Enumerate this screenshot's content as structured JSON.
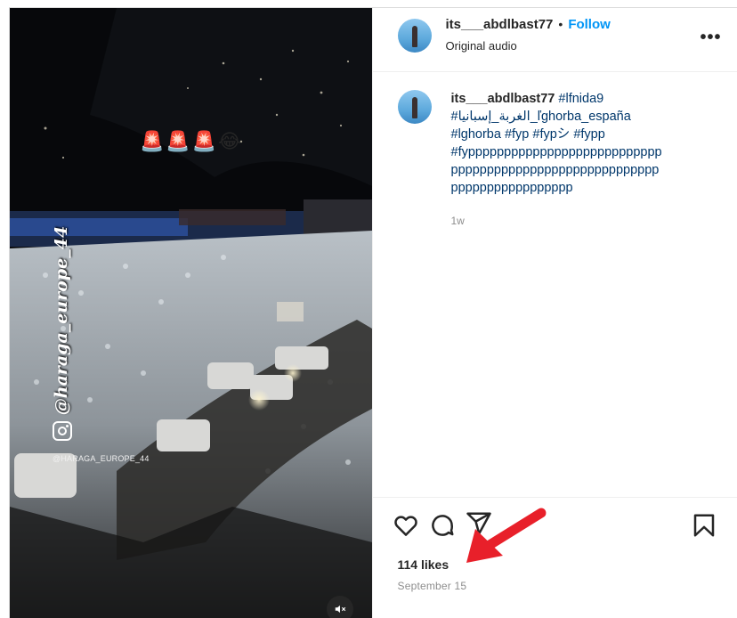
{
  "media": {
    "emoji_row": "🚨🚨🚨😂",
    "watermark_vertical": "@haraga_europe_44",
    "watermark_small": "@HARAGA_EUROPE_44",
    "icons": [
      "instagram-logo-icon",
      "mute-icon"
    ]
  },
  "header": {
    "username": "its___abdlbast77",
    "separator": "•",
    "follow_label": "Follow",
    "subtitle": "Original audio",
    "more_label": "•••"
  },
  "caption": {
    "username": "its___abdlbast77",
    "tag_1": "#lfnida9",
    "tag_2": "#الغربة_إسبانيا_ľghorba_españa",
    "line_3_tags": "#lghorba #fyp #fypシ #fypp",
    "tag_long_1": "#fyppppppppppppppppppppppppppp",
    "tag_long_2": "ppppppppppppppppppppppppppppp",
    "tag_long_3": "ppppppppppppppppp",
    "time_ago": "1w"
  },
  "actions": {
    "icons": [
      "heart-icon",
      "comment-icon",
      "share-icon",
      "bookmark-icon"
    ],
    "likes": "114 likes",
    "date": "September 15"
  },
  "colors": {
    "accent": "#0095f6",
    "hashtag": "#00376b",
    "annotation_arrow": "#e8202a",
    "secondary_text": "#8e8e8e"
  }
}
